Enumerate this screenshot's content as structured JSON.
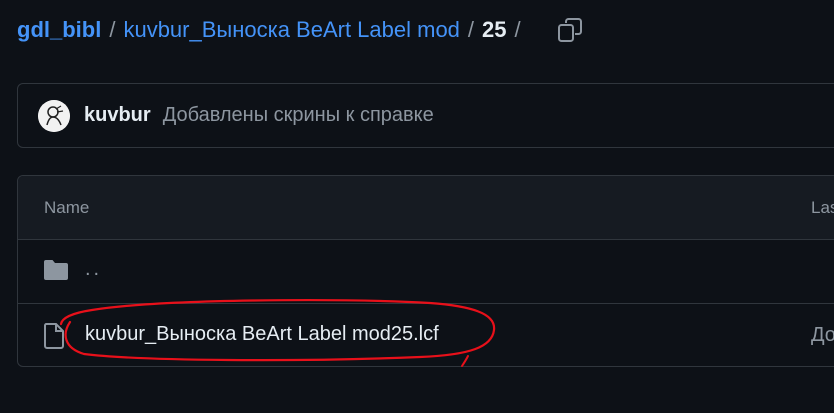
{
  "breadcrumb": {
    "repo": "gdl_bibl",
    "folder": "kuvbur_Выноска BeArt Label mod",
    "current": "25",
    "separator": "/"
  },
  "commit": {
    "author": "kuvbur",
    "message": "Добавлены скрины к справке"
  },
  "table": {
    "headers": {
      "name": "Name",
      "last_commit": "Las"
    },
    "parent_dir": "..",
    "files": [
      {
        "name": "kuvbur_Выноска BeArt Label mod25.lcf",
        "last_commit": "До"
      }
    ]
  },
  "colors": {
    "background": "#0d1117",
    "link": "#4493f8",
    "muted": "#8d96a0",
    "border": "#30363d",
    "annotation": "#e8101a"
  },
  "icons": {
    "copy": "copy-icon",
    "folder": "folder-icon",
    "file": "file-icon"
  }
}
